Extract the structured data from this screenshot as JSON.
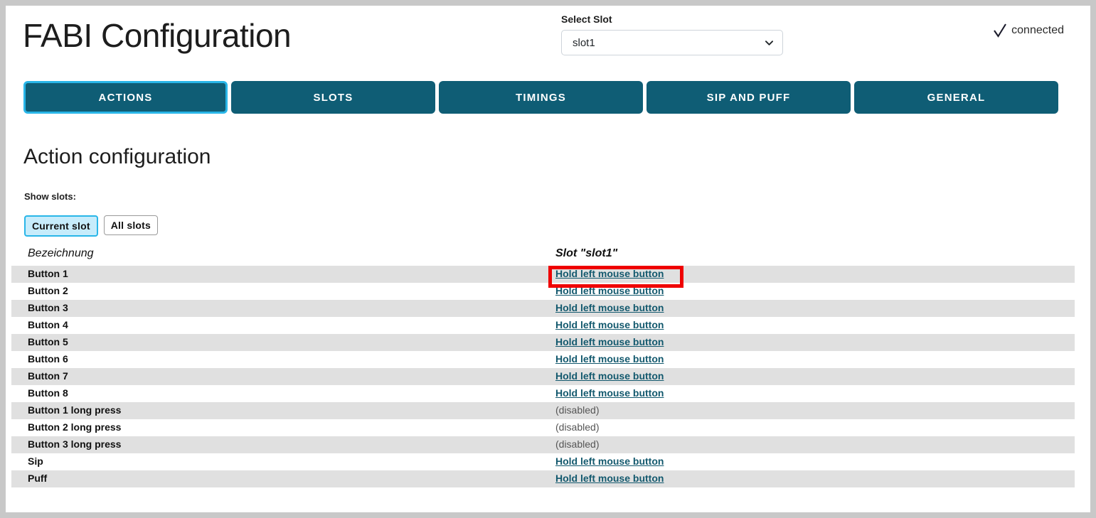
{
  "header": {
    "title": "FABI Configuration",
    "slot_select": {
      "label": "Select Slot",
      "value": "slot1",
      "chevron_icon": "chevron-down-icon"
    },
    "connection": {
      "icon": "checkmark-icon",
      "label": "connected"
    }
  },
  "tabs": [
    {
      "label": "ACTIONS",
      "active": true
    },
    {
      "label": "SLOTS",
      "active": false
    },
    {
      "label": "TIMINGS",
      "active": false
    },
    {
      "label": "SIP AND PUFF",
      "active": false
    },
    {
      "label": "GENERAL",
      "active": false
    }
  ],
  "main": {
    "section_title": "Action configuration",
    "show_slots_label": "Show slots:",
    "show_slots_buttons": [
      {
        "label": "Current slot",
        "active": true
      },
      {
        "label": "All slots",
        "active": false
      }
    ],
    "table": {
      "headers": {
        "name": "Bezeichnung",
        "value": "Slot \"slot1\""
      },
      "rows": [
        {
          "name": "Button 1",
          "value": "Hold left mouse button",
          "link": true
        },
        {
          "name": "Button 2",
          "value": "Hold left mouse button",
          "link": true
        },
        {
          "name": "Button 3",
          "value": "Hold left mouse button",
          "link": true
        },
        {
          "name": "Button 4",
          "value": "Hold left mouse button",
          "link": true
        },
        {
          "name": "Button 5",
          "value": "Hold left mouse button",
          "link": true
        },
        {
          "name": "Button 6",
          "value": "Hold left mouse button",
          "link": true
        },
        {
          "name": "Button 7",
          "value": "Hold left mouse button",
          "link": true
        },
        {
          "name": "Button 8",
          "value": "Hold left mouse button",
          "link": true
        },
        {
          "name": "Button 1 long press",
          "value": "(disabled)",
          "link": false
        },
        {
          "name": "Button 2 long press",
          "value": "(disabled)",
          "link": false
        },
        {
          "name": "Button 3 long press",
          "value": "(disabled)",
          "link": false
        },
        {
          "name": "Sip",
          "value": "Hold left mouse button",
          "link": true
        },
        {
          "name": "Puff",
          "value": "Hold left mouse button",
          "link": true
        }
      ]
    }
  },
  "annotation": {
    "highlight_color": "#ef0000",
    "target": "Hold left mouse button"
  },
  "colors": {
    "tab_fill": "#0f5d75",
    "tab_active_border": "#29b6e8",
    "toggle_active_fill": "#c7ecfb",
    "link": "#13596e",
    "row_stripe": "#e0e0e0",
    "page_background": "#c8c8c8"
  }
}
